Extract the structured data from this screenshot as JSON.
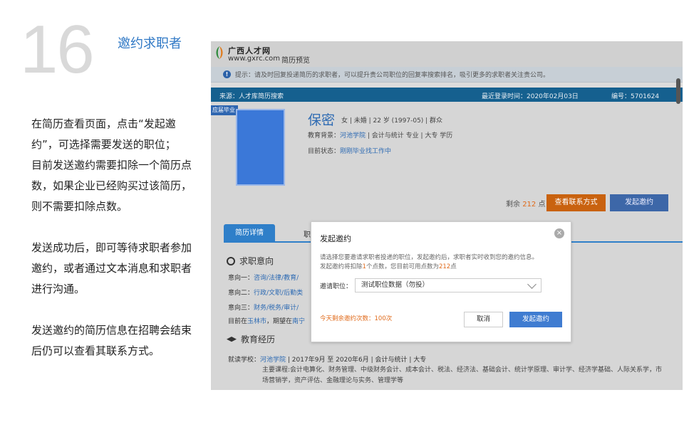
{
  "step": {
    "number": "16",
    "title": "邀约求职者"
  },
  "instructions": [
    "在简历查看页面，点击“发起邀约”，可选择需要发送的职位；",
    "目前发送邀约需要扣除一个简历点数，如果企业已经购买过该简历，则不需要扣除点数。",
    "",
    "发送成功后，即可等待求职者参加邀约，或者通过文本消息和求职者进行沟通。",
    "",
    "发送邀约的简历信息在招聘会结束后仍可以查看其联系方式。"
  ],
  "screenshot": {
    "logo": {
      "name": "广西人才网",
      "url": "www.gxrc.com",
      "section": "简历预览"
    },
    "notice": "提示：请及时回复投递简历的求职者，可以提升贵公司职位的回复率搜索排名，吸引更多的求职者关注贵公司。",
    "source_bar": {
      "source": "来源：人才库简历搜索",
      "last_login": "最近登录时间：2020年02月03日",
      "id": "编号：5701624"
    },
    "ribbon": "应届毕业",
    "candidate": {
      "name": "保密",
      "attrs": "女 |  未婚  |  22 岁 (1997-05)  |  群众",
      "edu_prefix": "教育背景：",
      "edu_school": "河池学院",
      "edu_rest": " |  会计与统计 专业  |  大专 学历",
      "status_prefix": "目前状态：",
      "status_value": "刚刚毕业找工作中"
    },
    "points": {
      "prefix": "剩余",
      "value": "212",
      "suffix": "点"
    },
    "buttons": {
      "contact": "查看联系方式",
      "invite": "发起邀约"
    },
    "tabs": {
      "active": "简历详情",
      "other": "职"
    },
    "intent": {
      "heading": "求职意向",
      "rows": [
        {
          "label": "意向一：",
          "value": "咨询/法律/教育/"
        },
        {
          "label": "意向二：",
          "value": "行政/文职/后勤类"
        },
        {
          "label": "意向三：",
          "value": "财务/税务/审计/"
        }
      ],
      "location_prefix": "目前在",
      "location_city": "玉林市",
      "location_mid": "，期望在",
      "location_target": "南宁"
    },
    "education": {
      "heading": "教育经历",
      "school_label": "就读学校：",
      "school": "河池学院",
      "detail": " | 2017年9月 至 2020年6月  |  会计与统计  |  大专",
      "courses": "主要课程:会计电算化、财务管理、中级财务会计、成本会计、税法、经济法、基础会计、统计学原理、审计学、经济学基础、人际关系学，市场营销学，资产评估、金融理论与实务、管理学等"
    },
    "modal": {
      "title": "发起邀约",
      "desc_line1": "请选择您要邀请求职者投递的职位，发起邀约后，求职者实时收到您的邀约信息。",
      "desc_line2_a": "发起邀约将扣除",
      "desc_line2_b": "1",
      "desc_line2_c": "个点数，您目前可用点数为",
      "desc_line2_d": "212",
      "desc_line2_e": "点",
      "position_label": "邀请职位：",
      "position_value": "测试职位数据（勿投）",
      "remaining": "今天剩余邀约次数：100次",
      "cancel": "取消",
      "send": "发起邀约"
    }
  }
}
